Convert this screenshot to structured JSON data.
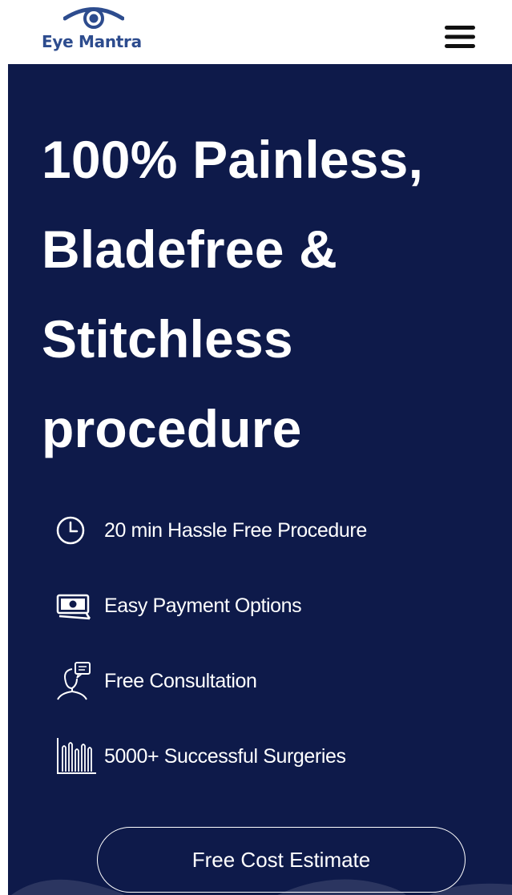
{
  "brand": {
    "logo_text": "Eye Mantra",
    "logo_color": "#2d4c8e"
  },
  "header": {
    "menu_icon": "hamburger-menu-icon"
  },
  "hero": {
    "background_color": "#0e1a4a",
    "headline_lines": [
      "100% Painless,",
      "Bladefree &",
      "Stitchless",
      "procedure"
    ],
    "features": [
      {
        "icon": "clock-icon",
        "label": "20 min Hassle Free Procedure"
      },
      {
        "icon": "money-icon",
        "label": "Easy Payment Options"
      },
      {
        "icon": "consultation-icon",
        "label": "Free Consultation"
      },
      {
        "icon": "surgeries-chart-icon",
        "label": "5000+ Successful Surgeries"
      }
    ],
    "cta_label": "Free Cost Estimate"
  }
}
